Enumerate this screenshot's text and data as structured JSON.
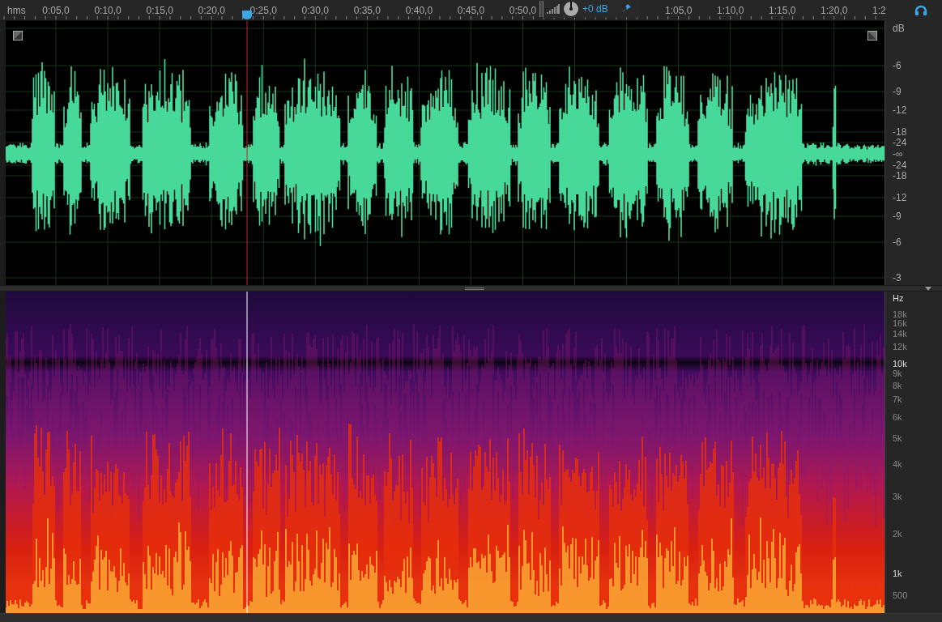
{
  "ruler": {
    "unit_label": "hms",
    "labels": [
      "0:05,0",
      "0:10,0",
      "0:15,0",
      "0:20,0",
      "0:25,0",
      "0:30,0",
      "0:35,0",
      "0:40,0",
      "0:45,0",
      "0:50,0",
      "1:05,0",
      "1:10,0",
      "1:15,0",
      "1:20,0",
      "1:2"
    ]
  },
  "hud": {
    "gain": "+0 dB"
  },
  "waveform_scale": {
    "labels": [
      "dB",
      "-6",
      "-9",
      "-12",
      "-18",
      "-24",
      "-∞",
      "-24",
      "-18",
      "-12",
      "-9",
      "-6",
      "-3"
    ]
  },
  "spectral_scale": {
    "labels": [
      {
        "text": "Hz",
        "kind": "major"
      },
      {
        "text": "18k",
        "kind": "minor"
      },
      {
        "text": "16k",
        "kind": "minor"
      },
      {
        "text": "14k",
        "kind": "minor"
      },
      {
        "text": "12k",
        "kind": "minor"
      },
      {
        "text": "10k",
        "kind": "major"
      },
      {
        "text": "9k",
        "kind": "minor"
      },
      {
        "text": "8k",
        "kind": "minor"
      },
      {
        "text": "7k",
        "kind": "minor"
      },
      {
        "text": "6k",
        "kind": "minor"
      },
      {
        "text": "5k",
        "kind": "minor"
      },
      {
        "text": "4k",
        "kind": "minor"
      },
      {
        "text": "3k",
        "kind": "minor"
      },
      {
        "text": "2k",
        "kind": "minor"
      },
      {
        "text": "1k",
        "kind": "major"
      },
      {
        "text": "500",
        "kind": "minor"
      }
    ]
  }
}
